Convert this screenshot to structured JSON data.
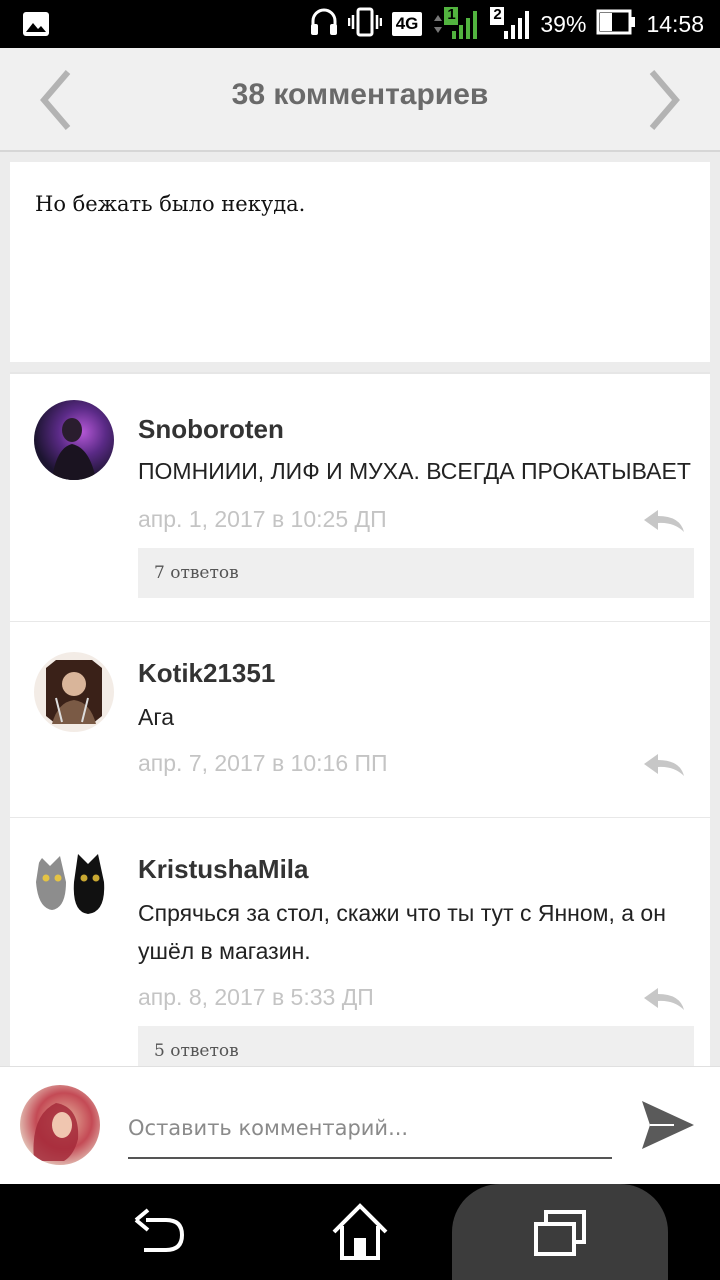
{
  "status_bar": {
    "network": "4G",
    "sim1": "1",
    "sim2": "2",
    "battery": "39%",
    "time": "14:58"
  },
  "header": {
    "title": "38 комментариев"
  },
  "post": {
    "text": "Но бежать было некуда."
  },
  "comments": [
    {
      "author": "Snoboroten",
      "text": "ПОМНИИИ, ЛИФ И МУХА. ВСЕГДА ПРОКАТЫВАЕТ",
      "date": "апр. 1, 2017 в 10:25 ДП",
      "replies": "7 ответов"
    },
    {
      "author": "Kotik21351",
      "text": "Ага",
      "date": "апр. 7, 2017 в 10:16 ПП",
      "replies": ""
    },
    {
      "author": "KristushaMila",
      "text": "Спрячься за стол, скажи что ты тут с Янном, а он ушёл в магазин.",
      "date": "апр. 8, 2017 в 5:33 ДП",
      "replies": "5 ответов"
    }
  ],
  "input": {
    "placeholder": "Оставить комментарий..."
  },
  "colors": {
    "header_bg": "#f0f0f0",
    "title": "#6a6a6a",
    "date": "#c4c4c4",
    "replies_bg": "#efefef"
  }
}
